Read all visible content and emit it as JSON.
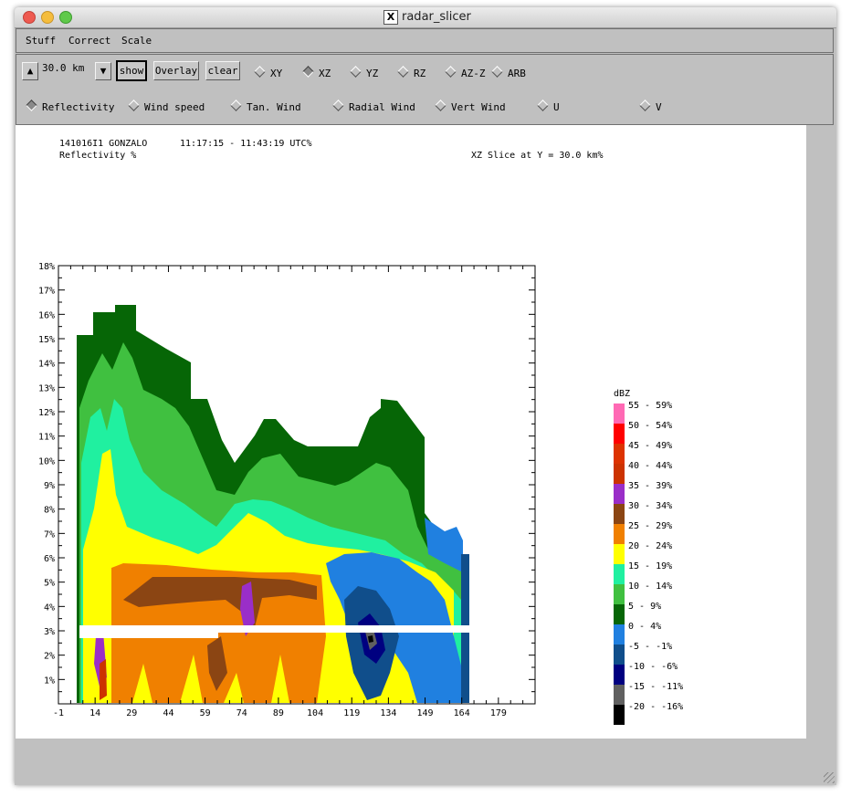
{
  "window": {
    "title": "radar_slicer"
  },
  "menu": {
    "items": [
      "Stuff",
      "Correct",
      "Scale"
    ]
  },
  "toolbar": {
    "distance": "30.0 km",
    "show_label": "show",
    "overlay_label": "Overlay",
    "clear_label": "clear",
    "slice_modes": [
      {
        "label": "XY",
        "selected": false
      },
      {
        "label": "XZ",
        "selected": true
      },
      {
        "label": "YZ",
        "selected": false
      },
      {
        "label": "RZ",
        "selected": false
      },
      {
        "label": "AZ-Z",
        "selected": false
      },
      {
        "label": "ARB",
        "selected": false
      }
    ],
    "fields": [
      {
        "label": "Reflectivity",
        "selected": true
      },
      {
        "label": "Wind speed",
        "selected": false
      },
      {
        "label": "Tan. Wind",
        "selected": false
      },
      {
        "label": "Radial Wind",
        "selected": false
      },
      {
        "label": "Vert Wind",
        "selected": false
      },
      {
        "label": "U",
        "selected": false
      },
      {
        "label": "V",
        "selected": false
      }
    ]
  },
  "plot": {
    "header_id": "141016I1 GONZALO",
    "header_time": "11:17:15 - 11:43:19 UTC%",
    "field_label": "Reflectivity %",
    "slice_label": "XZ Slice at Y = 30.0 km%"
  },
  "colors": {
    "ge55": "#ff69b4",
    "50": "#ff0000",
    "45": "#dd3300",
    "40": "#cc3300",
    "35": "#9a2ec8",
    "30": "#8b4513",
    "25": "#f08000",
    "20": "#ffff00",
    "15": "#20f0a0",
    "10": "#40c040",
    "5": "#066606",
    "0": "#2080e0",
    "m5": "#104e8b",
    "m10": "#000080",
    "m15": "#606060",
    "m20": "#000000"
  },
  "chart_data": {
    "type": "heatmap",
    "xlabel": "",
    "ylabel": "",
    "xlim": [
      -1,
      194
    ],
    "ylim": [
      0,
      18
    ],
    "x_ticks": [
      "-1",
      "14",
      "29",
      "44",
      "59",
      "74",
      "89",
      "104",
      "119",
      "134",
      "149",
      "164",
      "179"
    ],
    "y_ticks": [
      "1%",
      "2%",
      "3%",
      "4%",
      "5%",
      "6%",
      "7%",
      "8%",
      "9%",
      "10%",
      "11%",
      "12%",
      "13%",
      "14%",
      "15%",
      "16%",
      "17%",
      "18%"
    ],
    "legend_title": "dBZ",
    "legend": [
      {
        "label": "55 - 59%",
        "color": "#ff69b4"
      },
      {
        "label": "50 - 54%",
        "color": "#ff0000"
      },
      {
        "label": "45 - 49%",
        "color": "#dd3300"
      },
      {
        "label": "40 - 44%",
        "color": "#cc3300"
      },
      {
        "label": "35 - 39%",
        "color": "#9a2ec8"
      },
      {
        "label": "30 - 34%",
        "color": "#8b4513"
      },
      {
        "label": "25 - 29%",
        "color": "#f08000"
      },
      {
        "label": "20 - 24%",
        "color": "#ffff00"
      },
      {
        "label": "15 - 19%",
        "color": "#20f0a0"
      },
      {
        "label": "10 - 14%",
        "color": "#40c040"
      },
      {
        "label": "5 - 9%",
        "color": "#066606"
      },
      {
        "label": "0 - 4%",
        "color": "#2080e0"
      },
      {
        "label": "-5 - -1%",
        "color": "#104e8b"
      },
      {
        "label": "-10 - -6%",
        "color": "#000080"
      },
      {
        "label": "-15 - -11%",
        "color": "#606060"
      },
      {
        "label": "-20 - -16%",
        "color": "#000000"
      }
    ],
    "missing_band_km": [
      2.6,
      3.1
    ]
  }
}
